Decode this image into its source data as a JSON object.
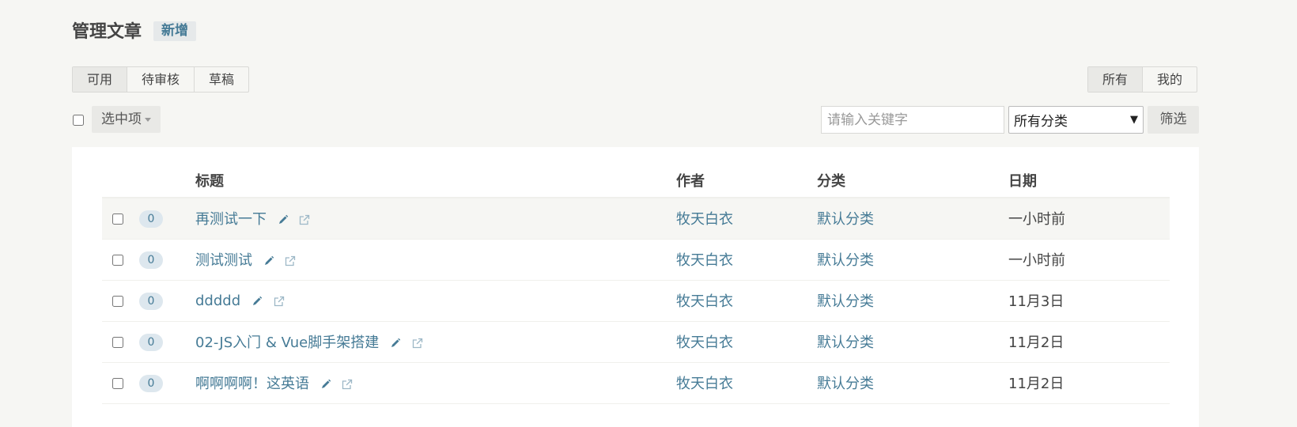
{
  "header": {
    "title": "管理文章",
    "add_label": "新增"
  },
  "status_tabs": [
    {
      "label": "可用",
      "active": true
    },
    {
      "label": "待审核",
      "active": false
    },
    {
      "label": "草稿",
      "active": false
    }
  ],
  "owner_tabs": [
    {
      "label": "所有",
      "active": true
    },
    {
      "label": "我的",
      "active": false
    }
  ],
  "toolbar": {
    "selected_label": "选中项",
    "search_placeholder": "请输入关键字",
    "category_value": "所有分类",
    "filter_label": "筛选"
  },
  "table": {
    "columns": [
      "标题",
      "作者",
      "分类",
      "日期"
    ],
    "rows": [
      {
        "count": "0",
        "title": "再测试一下",
        "author": "牧天白衣",
        "category": "默认分类",
        "date": "一小时前"
      },
      {
        "count": "0",
        "title": "测试测试",
        "author": "牧天白衣",
        "category": "默认分类",
        "date": "一小时前"
      },
      {
        "count": "0",
        "title": "ddddd",
        "author": "牧天白衣",
        "category": "默认分类",
        "date": "11月3日"
      },
      {
        "count": "0",
        "title": "02-JS入门 & Vue脚手架搭建",
        "author": "牧天白衣",
        "category": "默认分类",
        "date": "11月2日"
      },
      {
        "count": "0",
        "title": "啊啊啊啊！这英语",
        "author": "牧天白衣",
        "category": "默认分类",
        "date": "11月2日"
      }
    ]
  },
  "colors": {
    "link": "#467b96",
    "background": "#f6f6f3",
    "badge_bg": "#dde7ee"
  },
  "icons": {
    "edit": "pencil-icon",
    "view": "external-link-icon"
  }
}
